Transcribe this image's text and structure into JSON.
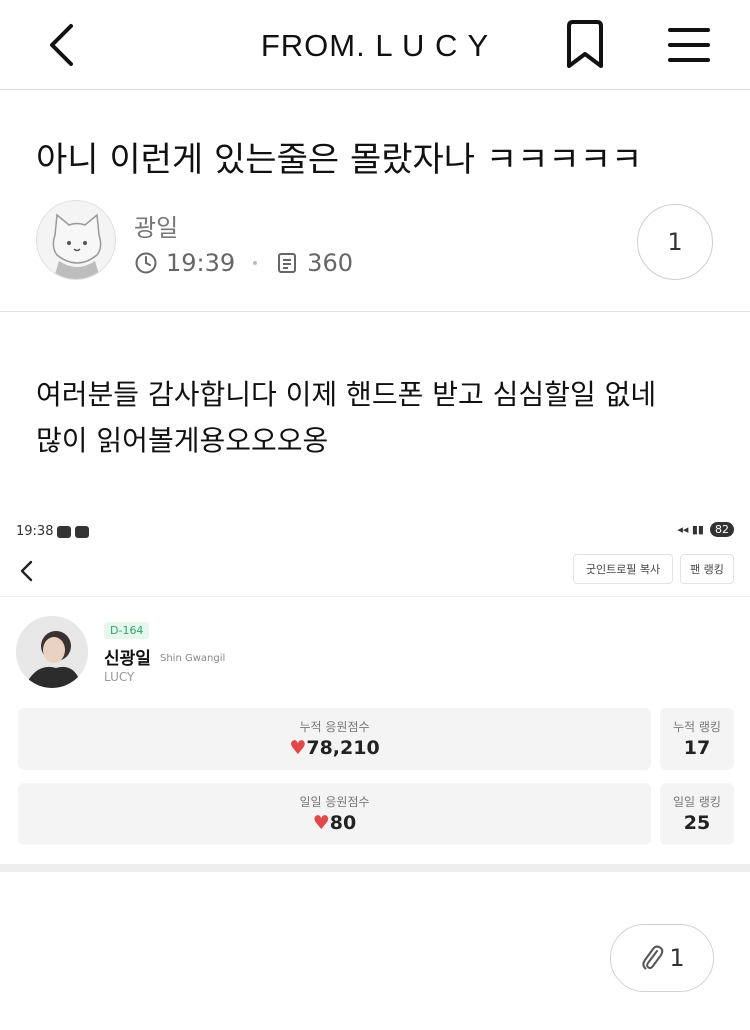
{
  "header": {
    "title": "FROM. L U C Y"
  },
  "post": {
    "title": "아니 이런게 있는줄은 몰랐자나 ㅋㅋㅋㅋㅋ",
    "author": "광일",
    "time": "19:39",
    "views": "360",
    "comment_count": "1",
    "body_line1": "여러분들 감사합니다 이제 핸드폰 받고 심심할일 없네",
    "body_line2": "많이 읽어볼게용오오오옹"
  },
  "embedded_screenshot": {
    "status_time": "19:38",
    "battery": "82",
    "copy_button": "굿인트로필 복사",
    "rank_button": "팬 랭킹",
    "dday": "D-164",
    "name": "신광일",
    "name_en": "Shin Gwangil",
    "group": "LUCY",
    "cumulative_label": "누적 응원점수",
    "cumulative_value": "78,210",
    "cumulative_rank_label": "누적 랭킹",
    "cumulative_rank": "17",
    "daily_label": "일일 응원점수",
    "daily_value": "80",
    "daily_rank_label": "일일 랭킹",
    "daily_rank": "25"
  },
  "attachments": {
    "count": "1"
  },
  "icons": [
    "back-icon",
    "bookmark-icon",
    "menu-icon",
    "clock-icon",
    "document-icon",
    "heart-icon",
    "paperclip-icon"
  ]
}
